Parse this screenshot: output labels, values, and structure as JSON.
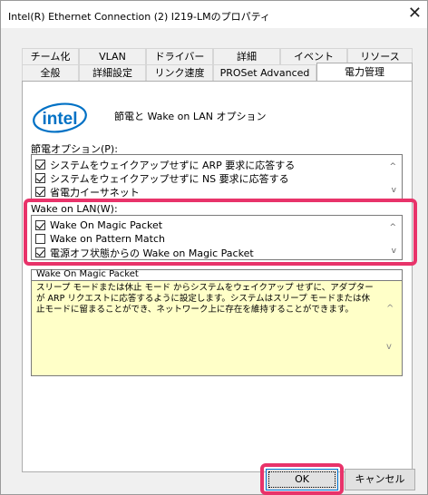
{
  "window": {
    "title": "Intel(R) Ethernet Connection (2) I219-LMのプロパティ",
    "close_icon": "close-icon"
  },
  "tabs": {
    "row1": [
      "チーム化",
      "VLAN",
      "ドライバー",
      "詳細",
      "イベント",
      "リソース"
    ],
    "row2": [
      "全般",
      "詳細設定",
      "リンク速度",
      "PROSet Advanced",
      "電力管理"
    ],
    "active": "電力管理"
  },
  "header": {
    "logo_text": "intel",
    "title": "節電と Wake on LAN オプション"
  },
  "power_saving": {
    "label": "節電オプション(P):",
    "items": [
      {
        "label": "システムをウェイクアップせずに ARP 要求に応答する",
        "checked": true
      },
      {
        "label": "システムをウェイクアップせずに NS 要求に応答する",
        "checked": true
      },
      {
        "label": "省電力イーサネット",
        "checked": true
      }
    ]
  },
  "wake_on_lan": {
    "label": "Wake on LAN(W):",
    "items": [
      {
        "label": "Wake On Magic Packet",
        "checked": true
      },
      {
        "label": "Wake on Pattern Match",
        "checked": false
      },
      {
        "label": "電源オフ状態からの Wake on Magic Packet",
        "checked": true
      }
    ]
  },
  "description": {
    "title": "Wake On Magic Packet",
    "text": "スリープ モードまたは休止 モード からシステムをウェイクアップ せずに、アダプターが ARP リクエストに応答するように設定します。システムはスリープ モードまたは休止モードに留まることができ、ネットワーク上に存在を維持することができます。"
  },
  "buttons": {
    "ok": "OK",
    "cancel": "キャンセル"
  },
  "colors": {
    "highlight": "#e8336a",
    "intel_blue": "#0071c5",
    "description_bg": "#ffffc8"
  }
}
